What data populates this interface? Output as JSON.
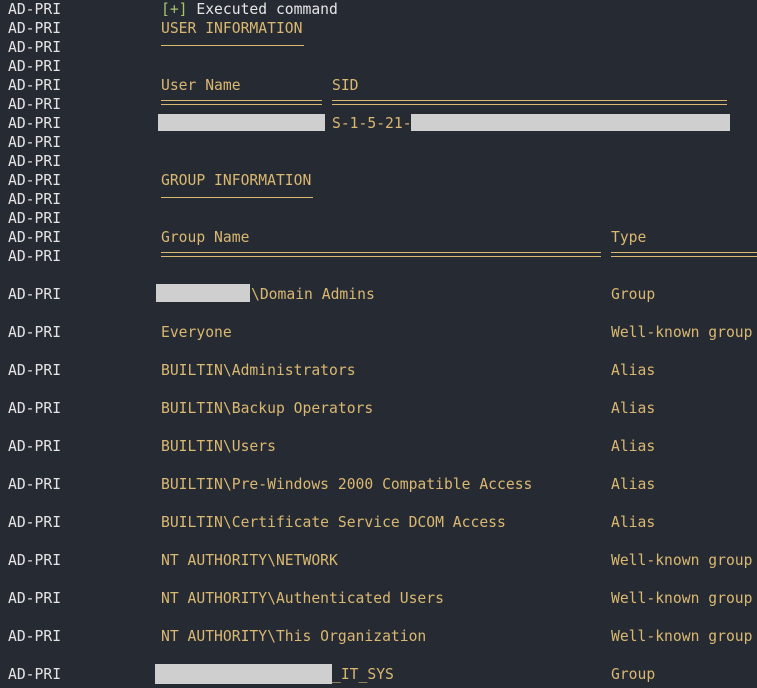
{
  "host_label": "AD-PRI",
  "status": {
    "prefix": "[+]",
    "text": " Executed command"
  },
  "user_section": {
    "heading": "USER INFORMATION",
    "col_user": "User Name",
    "col_sid": "SID",
    "sid_prefix": "S-1-5-21-"
  },
  "group_section": {
    "heading": "GROUP INFORMATION",
    "col_group": "Group Name",
    "col_type": "Type",
    "rows": [
      {
        "name": "\\Domain Admins",
        "type": "Group"
      },
      {
        "name": "Everyone",
        "type": "Well-known group"
      },
      {
        "name": "BUILTIN\\Administrators",
        "type": "Alias"
      },
      {
        "name": "BUILTIN\\Backup Operators",
        "type": "Alias"
      },
      {
        "name": "BUILTIN\\Users",
        "type": "Alias"
      },
      {
        "name": "BUILTIN\\Pre-Windows 2000 Compatible Access",
        "type": "Alias"
      },
      {
        "name": "BUILTIN\\Certificate Service DCOM Access",
        "type": "Alias"
      },
      {
        "name": "NT AUTHORITY\\NETWORK",
        "type": "Well-known group"
      },
      {
        "name": "NT AUTHORITY\\Authenticated Users",
        "type": "Well-known group"
      },
      {
        "name": "NT AUTHORITY\\This Organization",
        "type": "Well-known group"
      },
      {
        "name": "_IT_SYS",
        "type": "Group"
      }
    ]
  }
}
